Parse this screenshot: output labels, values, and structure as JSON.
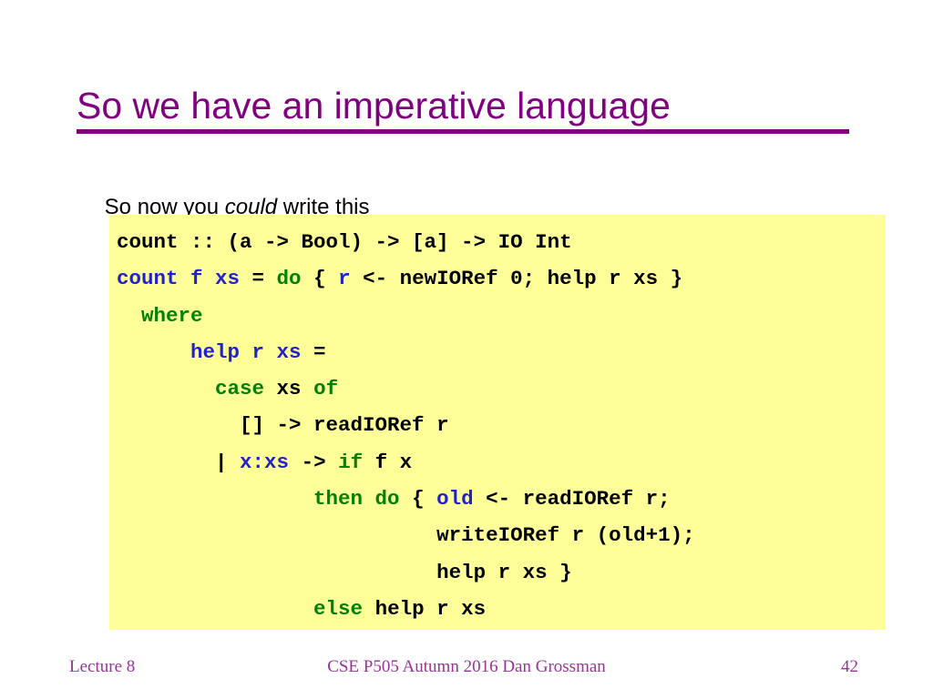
{
  "slide": {
    "title": "So we have an imperative language",
    "accent_color": "#800080",
    "subtitle": {
      "before": "So now you ",
      "emphasis": "could",
      "after": " write this"
    },
    "code": {
      "background_color": "#ffff99",
      "keyword_color": "#008000",
      "identifier_color": "#2222cc",
      "text_color": "#000000",
      "plain_text": "count :: (a -> Bool) -> [a] -> IO Int\ncount f xs = do { r <- newIORef 0; help r xs }\n  where\n      help r xs =\n        case xs of\n          [] -> readIORef r\n        | x:xs -> if f x\n                then do { old <- readIORef r;\n                          writeIORef r (old+1);\n                          help r xs }\n                else help r xs",
      "lines": [
        {
          "indent": 0,
          "tokens": [
            {
              "text": "count :: (a -> Bool) -> [a] -> IO Int",
              "color": "black"
            }
          ]
        },
        {
          "indent": 0,
          "tokens": [
            {
              "text": "count f xs",
              "color": "blue"
            },
            {
              "text": " = ",
              "color": "black"
            },
            {
              "text": "do",
              "color": "green"
            },
            {
              "text": " { ",
              "color": "black"
            },
            {
              "text": "r",
              "color": "blue"
            },
            {
              "text": " <- newIORef 0; help r xs }",
              "color": "black"
            }
          ]
        },
        {
          "indent": 2,
          "tokens": [
            {
              "text": "where",
              "color": "green"
            }
          ]
        },
        {
          "indent": 6,
          "tokens": [
            {
              "text": "help r xs",
              "color": "blue"
            },
            {
              "text": " =",
              "color": "black"
            }
          ]
        },
        {
          "indent": 8,
          "tokens": [
            {
              "text": "case",
              "color": "green"
            },
            {
              "text": " xs ",
              "color": "black"
            },
            {
              "text": "of",
              "color": "green"
            }
          ]
        },
        {
          "indent": 10,
          "tokens": [
            {
              "text": "[] -> readIORef r",
              "color": "black"
            }
          ]
        },
        {
          "indent": 8,
          "tokens": [
            {
              "text": "| ",
              "color": "black"
            },
            {
              "text": "x:xs",
              "color": "blue"
            },
            {
              "text": " -> ",
              "color": "black"
            },
            {
              "text": "if",
              "color": "green"
            },
            {
              "text": " f x",
              "color": "black"
            }
          ]
        },
        {
          "indent": 16,
          "tokens": [
            {
              "text": "then do",
              "color": "green"
            },
            {
              "text": " { ",
              "color": "black"
            },
            {
              "text": "old",
              "color": "blue"
            },
            {
              "text": " <- readIORef r;",
              "color": "black"
            }
          ]
        },
        {
          "indent": 26,
          "tokens": [
            {
              "text": "writeIORef r (old+1);",
              "color": "black"
            }
          ]
        },
        {
          "indent": 26,
          "tokens": [
            {
              "text": "help r xs }",
              "color": "black"
            }
          ]
        },
        {
          "indent": 16,
          "tokens": [
            {
              "text": "else",
              "color": "green"
            },
            {
              "text": " help r xs",
              "color": "black"
            }
          ]
        }
      ]
    },
    "footer": {
      "left": "Lecture 8",
      "center": "CSE P505 Autumn 2016  Dan Grossman",
      "right": "42",
      "color": "#993399"
    }
  }
}
